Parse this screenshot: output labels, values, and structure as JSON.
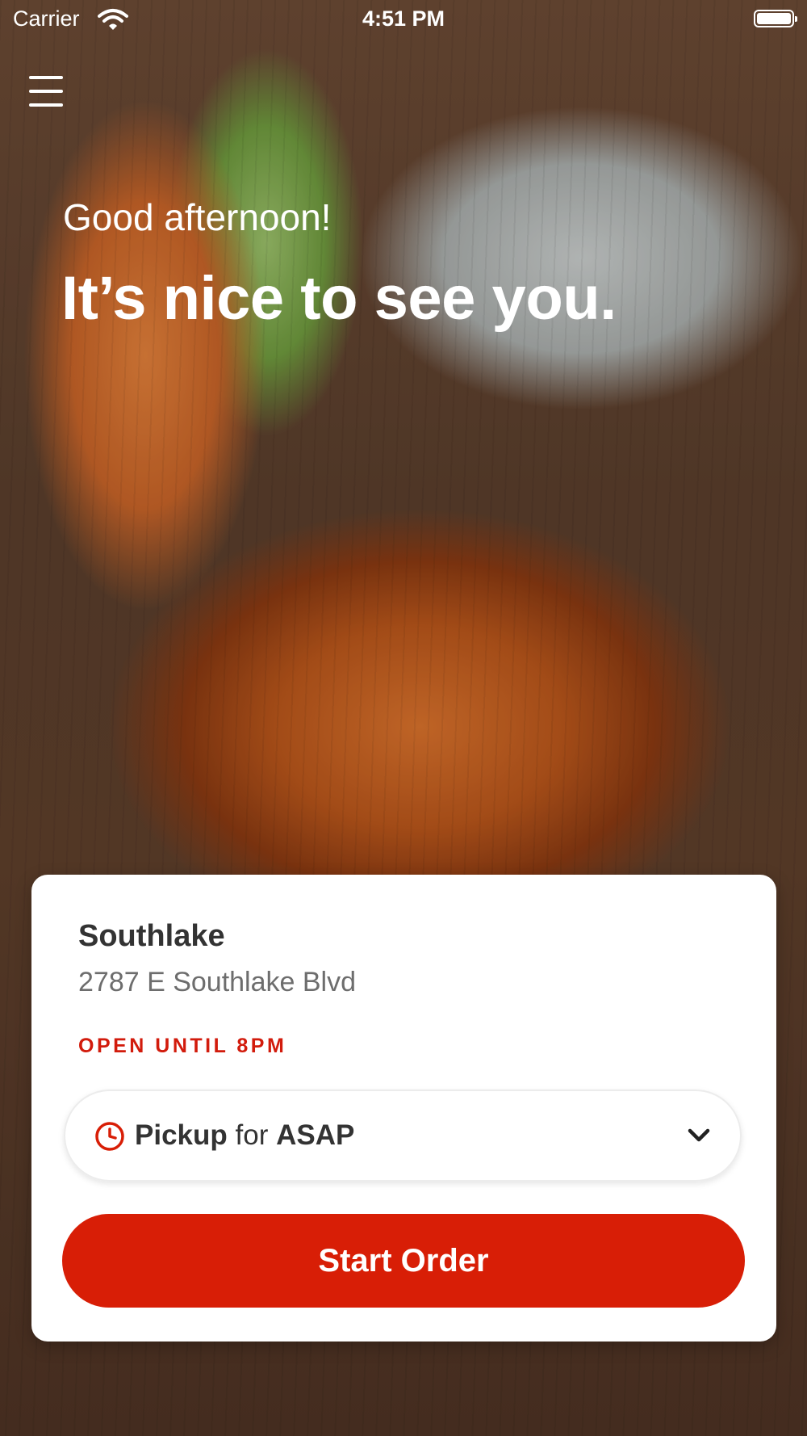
{
  "status_bar": {
    "carrier": "Carrier",
    "time": "4:51 PM"
  },
  "header": {
    "greeting": "Good afternoon!",
    "headline": "It’s nice to see you."
  },
  "store": {
    "name": "Southlake",
    "address": "2787 E Southlake Blvd",
    "hours": "OPEN UNTIL 8PM"
  },
  "order_mode": {
    "mode": "Pickup",
    "connector": "for",
    "time": "ASAP"
  },
  "actions": {
    "start_order_label": "Start Order"
  },
  "colors": {
    "accent_red": "#d81e06",
    "hours_red": "#d21b0c"
  },
  "icons": [
    "wifi-icon",
    "battery-icon",
    "menu-icon",
    "clock-icon",
    "chevron-down-icon"
  ]
}
